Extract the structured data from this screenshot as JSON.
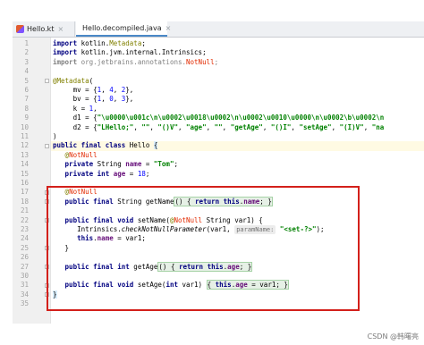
{
  "tabs": [
    {
      "label": "Hello.kt",
      "icon": "kotlin-file-icon",
      "active": false
    },
    {
      "label": "Hello.decompiled.java",
      "icon": "java-file-icon",
      "active": true
    }
  ],
  "close_glyph": "×",
  "lines": [
    {
      "n": "1",
      "html": "<span class=\"kw\">import</span> kotlin.<span class=\"an\">Metadata</span>;"
    },
    {
      "n": "2",
      "html": "<span class=\"kw\">import</span> kotlin.jvm.internal.Intrinsics;"
    },
    {
      "n": "3",
      "html": "<span class=\"kw dim\">import</span><span class=\"dim\"> org.jetbrains.annotations.</span><span class=\"nn\">NotNull</span><span class=\"dim\">;</span>"
    },
    {
      "n": "4",
      "html": ""
    },
    {
      "n": "5",
      "html": "<span class=\"an\">@Metadata</span>("
    },
    {
      "n": "6",
      "html": "     mv = {<span class=\"nu\">1</span>, <span class=\"nu\">4</span>, <span class=\"nu\">2</span>},"
    },
    {
      "n": "7",
      "html": "     bv = {<span class=\"nu\">1</span>, <span class=\"nu\">0</span>, <span class=\"nu\">3</span>},"
    },
    {
      "n": "8",
      "html": "     k = <span class=\"nu\">1</span>,"
    },
    {
      "n": "9",
      "html": "     d1 = {<span class=\"st\">\"\\u0000\\u001c\\n\\u0002\\u0018\\u0002\\n\\u0002\\u0010\\u0000\\n\\u0002\\b\\u0002\\n</span>"
    },
    {
      "n": "10",
      "html": "     d2 = {<span class=\"st\">\"LHello;\"</span>, <span class=\"st\">\"\"</span>, <span class=\"st\">\"()V\"</span>, <span class=\"st\">\"age\"</span>, <span class=\"st\">\"\"</span>, <span class=\"st\">\"getAge\"</span>, <span class=\"st\">\"()I\"</span>, <span class=\"st\">\"setAge\"</span>, <span class=\"st\">\"(I)V\"</span>, <span class=\"st\">\"na</span>"
    },
    {
      "n": "11",
      "html": ")"
    },
    {
      "n": "12",
      "html": "<span class=\"kw\">public final class</span> Hello <span class=\"brk\">{</span>"
    },
    {
      "n": "13",
      "html": "   <span class=\"an\">@</span><span class=\"nn\">NotNull</span>"
    },
    {
      "n": "14",
      "html": "   <span class=\"kw\">private</span> String <span class=\"fd\">name</span> = <span class=\"st\">\"Tom\"</span>;"
    },
    {
      "n": "15",
      "html": "   <span class=\"kw\">private int</span> <span class=\"fd\">age</span> = <span class=\"nu\">18</span>;"
    },
    {
      "n": "16",
      "html": ""
    },
    {
      "n": "17",
      "html": "   <span class=\"an\">@</span><span class=\"nn\">NotNull</span>"
    },
    {
      "n": "18",
      "html": "   <span class=\"kw\">public final</span> String getName<span class=\"fold-bracket\">() { <span class=\"kw\">return this</span>.<span class=\"fd\">name</span>; }</span>"
    },
    {
      "n": "21",
      "html": ""
    },
    {
      "n": "22",
      "html": "   <span class=\"kw\">public final void</span> setName(<span class=\"an\">@</span><span class=\"nn\">NotNull</span> String var1) {"
    },
    {
      "n": "23",
      "html": "      Intrinsics.<span class=\"it\">checkNotNullParameter</span>(var1, <span class=\"hintbox\">paramName:</span> <span class=\"st\">\"&lt;set-?&gt;\"</span>);"
    },
    {
      "n": "24",
      "html": "      <span class=\"kw\">this</span>.<span class=\"fd\">name</span> = var1;"
    },
    {
      "n": "25",
      "html": "   }"
    },
    {
      "n": "26",
      "html": ""
    },
    {
      "n": "27",
      "html": "   <span class=\"kw\">public final int</span> getAge<span class=\"fold-bracket\">() { <span class=\"kw\">return this</span>.<span class=\"fd\">age</span>; }</span>"
    },
    {
      "n": "30",
      "html": ""
    },
    {
      "n": "31",
      "html": "   <span class=\"kw\">public final void</span> setAge(<span class=\"kw\">int</span> var1) <span class=\"fold-bracket\">{ <span class=\"kw\">this</span>.<span class=\"fd\">age</span> = var1; }</span>"
    },
    {
      "n": "34",
      "html": "<span class=\"brk\">}</span>"
    },
    {
      "n": "35",
      "html": ""
    }
  ],
  "watermark": "CSDN @韩曙亮",
  "colors": {
    "highlight_box": "#d3201b",
    "keyword": "#000080",
    "string": "#008000"
  }
}
